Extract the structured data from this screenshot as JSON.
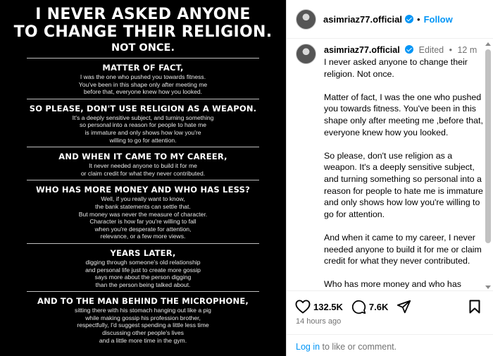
{
  "image": {
    "title_line1": "I NEVER ASKED ANYONE",
    "title_line2": "TO CHANGE THEIR RELIGION.",
    "title_line3": "NOT ONCE.",
    "sections": [
      {
        "head": "MATTER OF FACT,",
        "lines": [
          "I was the one who pushed you towards fitness.",
          "You've been in this shape only after meeting me",
          "before that, everyone knew how you looked."
        ]
      },
      {
        "head": "SO PLEASE, DON'T USE RELIGION AS A WEAPON.",
        "lines": [
          "It's a deeply sensitive subject, and turning something",
          "so personal into a reason for people to hate me",
          "is immature and only shows how low you're",
          "willing to go for attention."
        ]
      },
      {
        "head": "AND WHEN IT CAME TO MY CAREER,",
        "lines": [
          "It never needed anyone to build it for me",
          "or claim credit for what they never contributed."
        ]
      },
      {
        "head": "WHO HAS MORE MONEY AND WHO HAS LESS?",
        "lines": [
          "Well, if you really want to know,",
          "the bank statements can settle that.",
          "But money was never the measure of character.",
          "Character is how far you're willing to fall",
          "when you're desperate for attention,",
          "relevance, or a few more views."
        ]
      },
      {
        "head": "YEARS LATER,",
        "lines": [
          "digging through someone's old relationship",
          "and personal life just to create more gossip",
          "says more about the person digging",
          "than the person being talked about."
        ]
      },
      {
        "head": "AND TO THE MAN BEHIND THE MICROPHONE,",
        "lines": [
          "sitting there with his stomach hanging out like a pig",
          "while making gossip his profession   brother,",
          "respectfully, I'd suggest spending a little less time",
          "discussing other people's lives",
          "and a little more time in the gym."
        ]
      }
    ]
  },
  "header": {
    "username": "asimriaz77.official",
    "dot": "•",
    "follow_label": "Follow"
  },
  "caption": {
    "username": "asimriaz77.official",
    "edited": "Edited",
    "dot": "•",
    "time": "12 m",
    "paragraphs": [
      "I never asked anyone to change their religion. Not once.",
      "Matter of fact, I was the one who pushed you towards fitness. You've been in this shape only after meeting me ,before that, everyone knew how you looked.",
      "So please, don't use religion as a weapon. It's a deeply sensitive subject, and turning something so personal into a reason for people to hate me is immature and only shows how low you're willing to go for attention.",
      "And when it came to my career, I never needed anyone to build it for me or claim credit for what they never contributed.",
      "Who has more money and who has less?"
    ]
  },
  "actions": {
    "likes": "132.5K",
    "comments": "7.6K"
  },
  "time_ago": "14 hours ago",
  "login": {
    "link": "Log in",
    "rest": " to like or comment."
  },
  "colors": {
    "accent": "#0095f6",
    "verified": "#0095f6",
    "muted": "#737373",
    "image_bg": "#000000"
  },
  "icons": [
    "heart-icon",
    "comment-icon",
    "share-icon",
    "bookmark-icon",
    "verified-badge-icon"
  ]
}
